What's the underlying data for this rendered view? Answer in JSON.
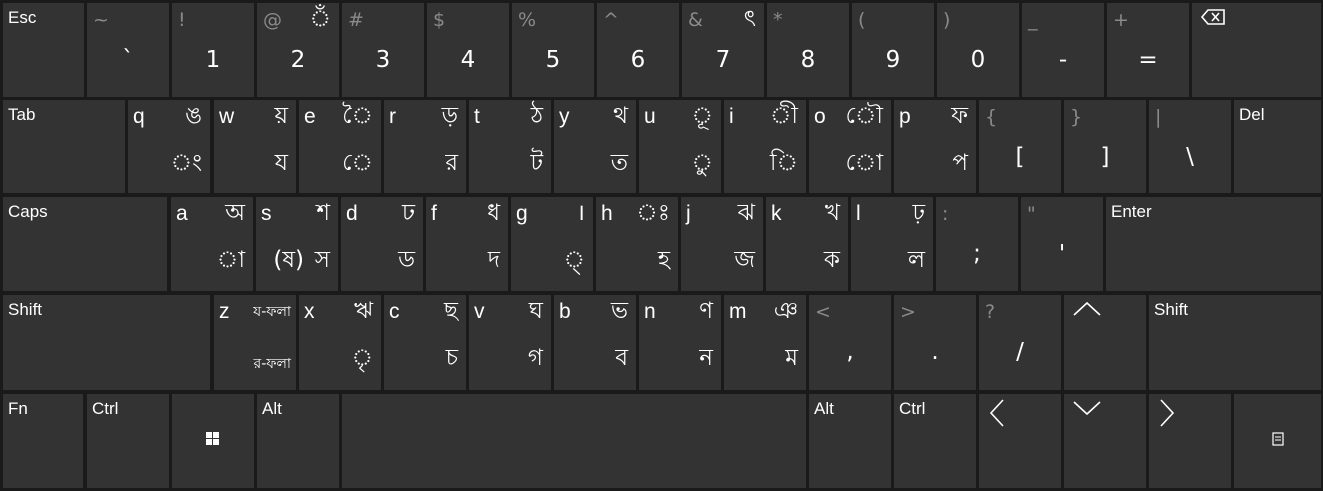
{
  "keyboard": {
    "row0": [
      {
        "name": "Esc"
      },
      {
        "shift": "~",
        "main": "`"
      },
      {
        "shift": "!",
        "main": "1"
      },
      {
        "shift": "@",
        "bn": "ঁ",
        "main": "2"
      },
      {
        "shift": "#",
        "main": "3"
      },
      {
        "shift": "$",
        "main": "4"
      },
      {
        "shift": "%",
        "main": "5"
      },
      {
        "shift": "^",
        "main": "6"
      },
      {
        "shift": "&",
        "bn": "ৎ",
        "main": "7"
      },
      {
        "shift": "*",
        "main": "8"
      },
      {
        "shift": "(",
        "main": "9"
      },
      {
        "shift": ")",
        "main": "0"
      },
      {
        "shift": "_",
        "main": "-"
      },
      {
        "shift": "+",
        "main": "="
      },
      {
        "icon": "backspace"
      }
    ],
    "tab": "Tab",
    "row1": [
      {
        "latin": "q",
        "top": "ঙ",
        "bot": "ং"
      },
      {
        "latin": "w",
        "top": "য়",
        "bot": "য"
      },
      {
        "latin": "e",
        "top": "ৈ",
        "bot": "ে"
      },
      {
        "latin": "r",
        "top": "ড়",
        "bot": "র"
      },
      {
        "latin": "t",
        "top": "ঠ",
        "bot": "ট"
      },
      {
        "latin": "y",
        "top": "থ",
        "bot": "ত"
      },
      {
        "latin": "u",
        "top": "ূ",
        "bot": "ু"
      },
      {
        "latin": "i",
        "top": "ী",
        "bot": "ি"
      },
      {
        "latin": "o",
        "top": "ৌ",
        "bot": "ো"
      },
      {
        "latin": "p",
        "top": "ফ",
        "bot": "প"
      },
      {
        "shift": "{",
        "main": "["
      },
      {
        "shift": "}",
        "main": "]"
      },
      {
        "shift": "|",
        "main": "\\"
      }
    ],
    "del": "Del",
    "caps": "Caps",
    "row2": [
      {
        "latin": "a",
        "top": "অ",
        "bot": "া"
      },
      {
        "latin": "s",
        "top": "শ",
        "bot": "স",
        "extra": "(ষ)"
      },
      {
        "latin": "d",
        "top": "ঢ",
        "bot": "ড"
      },
      {
        "latin": "f",
        "top": "ধ",
        "bot": "দ"
      },
      {
        "latin": "g",
        "top": "।",
        "bot": "্"
      },
      {
        "latin": "h",
        "top": "ঃ",
        "bot": "হ"
      },
      {
        "latin": "j",
        "top": "ঝ",
        "bot": "জ"
      },
      {
        "latin": "k",
        "top": "খ",
        "bot": "ক"
      },
      {
        "latin": "l",
        "top": "ঢ়",
        "bot": "ল"
      },
      {
        "shift": ":",
        "main": ";"
      },
      {
        "shift": "\"",
        "main": "'"
      }
    ],
    "enter": "Enter",
    "shift_left": "Shift",
    "row3": [
      {
        "latin": "z",
        "top": "য-ফলা",
        "bot": "র-ফলা",
        "small": true
      },
      {
        "latin": "x",
        "top": "ঋ",
        "bot": "ৃ"
      },
      {
        "latin": "c",
        "top": "ছ",
        "bot": "চ"
      },
      {
        "latin": "v",
        "top": "ঘ",
        "bot": "গ"
      },
      {
        "latin": "b",
        "top": "ভ",
        "bot": "ব"
      },
      {
        "latin": "n",
        "top": "ণ",
        "bot": "ন"
      },
      {
        "latin": "m",
        "top": "ঞ",
        "bot": "ম"
      },
      {
        "shift": "<",
        "main": ","
      },
      {
        "shift": ">",
        "main": "."
      },
      {
        "shift": "?",
        "main": "/"
      }
    ],
    "shift_right": "Shift",
    "fn": "Fn",
    "ctrl_left": "Ctrl",
    "alt_left": "Alt",
    "alt_right": "Alt",
    "ctrl_right": "Ctrl",
    "icons": {
      "backspace": "backspace-icon",
      "windows": "windows-icon",
      "arrow_up": "arrow-up-icon",
      "arrow_left": "arrow-left-icon",
      "arrow_down": "arrow-down-icon",
      "arrow_right": "arrow-right-icon",
      "menu": "menu-icon"
    },
    "colors": {
      "background": "#1a1a1a",
      "key": "#333333",
      "text": "#ffffff",
      "secondary": "#8a8a8a"
    }
  }
}
